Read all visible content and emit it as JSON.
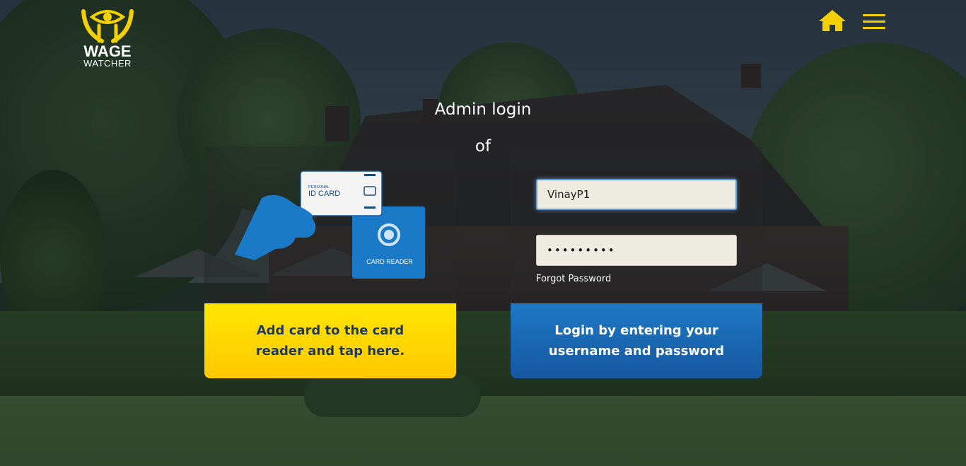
{
  "brand": {
    "name_line1": "WAGE",
    "name_line2": "WATCHER",
    "accent_color": "#f5d000"
  },
  "header": {
    "home_icon": "home-icon",
    "menu_icon": "hamburger-menu-icon"
  },
  "title": {
    "line1": "Admin login",
    "line2": "of"
  },
  "card_panel": {
    "illustration": {
      "card_small_label": "PERSONAL",
      "card_label": "ID CARD",
      "reader_label": "CARD READER"
    },
    "button_label": "Add card to the card reader and tap here."
  },
  "login_panel": {
    "username_value": "VinayP1",
    "password_value": "•••••••••",
    "forgot_label": "Forgot Password",
    "button_label": "Login by entering your username and password"
  },
  "colors": {
    "card_button": "#ffd400",
    "login_button": "#1a68b2",
    "button_text_dark": "#1e3a5f"
  }
}
